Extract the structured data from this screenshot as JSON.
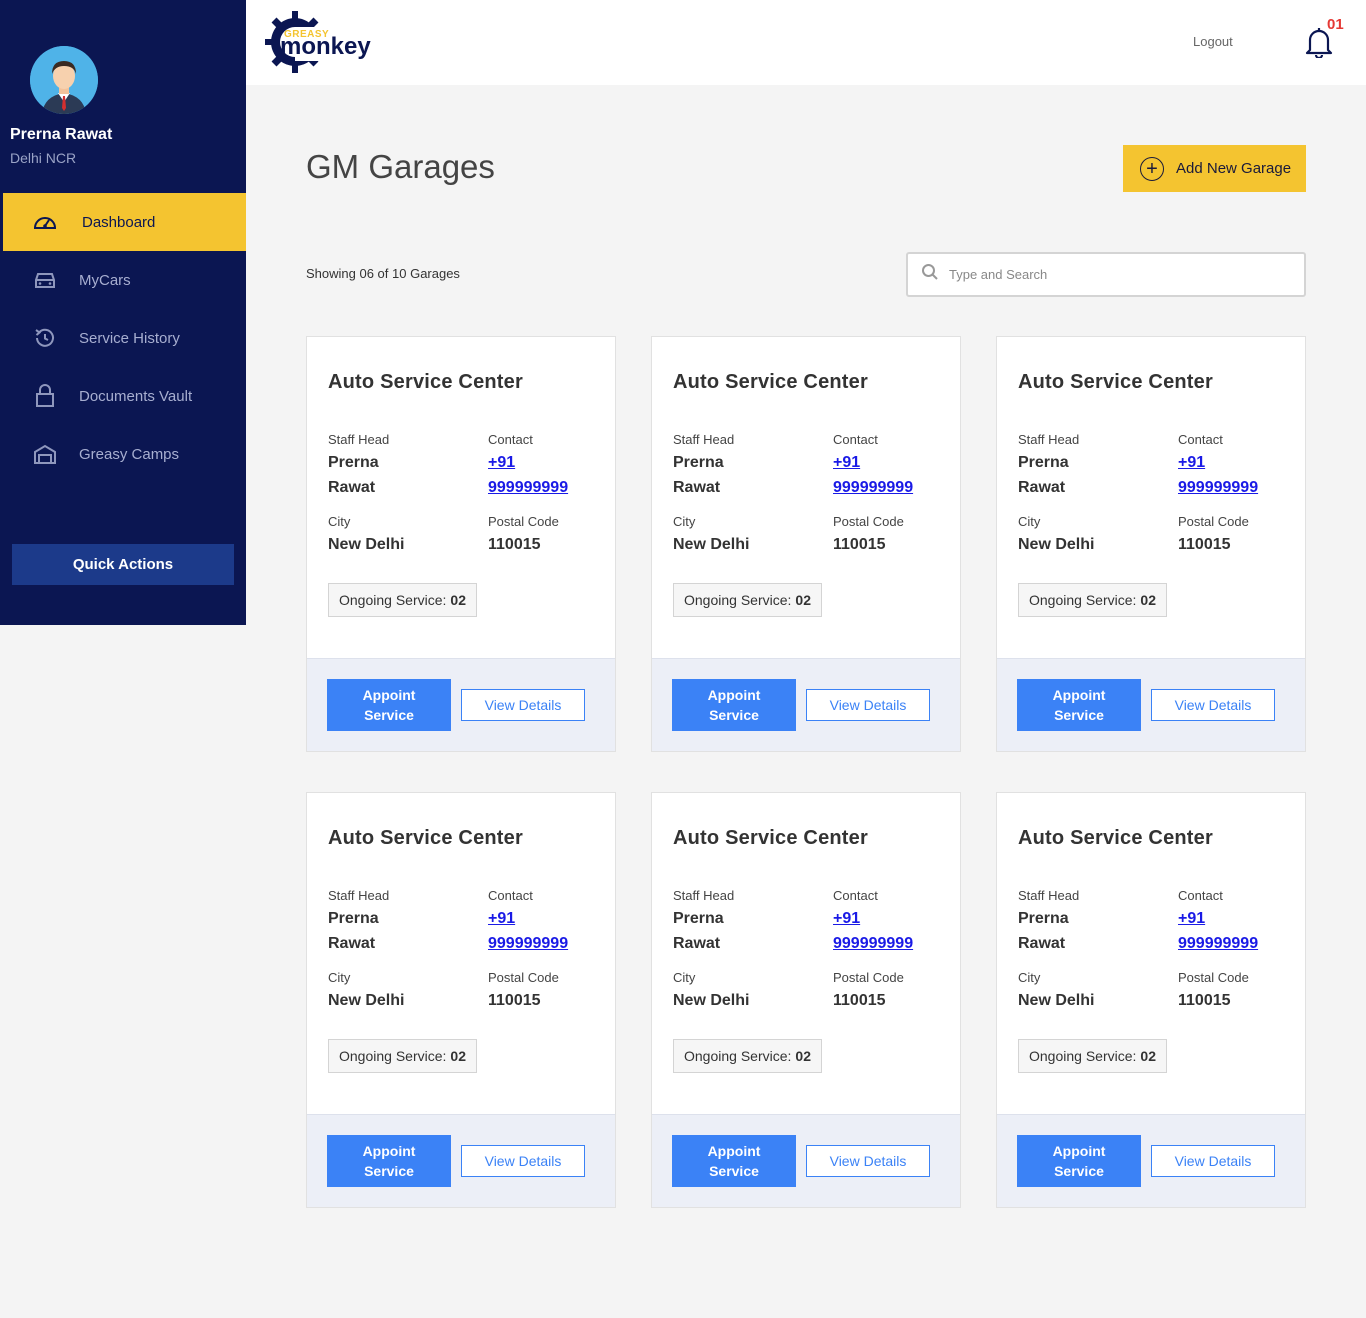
{
  "user": {
    "name": "Prerna Rawat",
    "location": "Delhi NCR"
  },
  "sidebar": {
    "items": [
      {
        "label": "Dashboard",
        "icon": "speedometer-icon",
        "active": true
      },
      {
        "label": "MyCars",
        "icon": "car-icon"
      },
      {
        "label": "Service History",
        "icon": "history-icon"
      },
      {
        "label": "Documents Vault",
        "icon": "lock-icon"
      },
      {
        "label": "Greasy Camps",
        "icon": "garage-icon"
      }
    ],
    "quick_actions": "Quick Actions"
  },
  "header": {
    "logo_top": "GREASY",
    "logo_main": "monkey",
    "logout": "Logout",
    "notification_count": "01"
  },
  "page": {
    "title": "GM Garages",
    "add_button": "Add New Garage",
    "showing": "Showing 06 of 10 Garages",
    "search_placeholder": "Type and Search"
  },
  "card_labels": {
    "staff_head": "Staff Head",
    "contact": "Contact",
    "city": "City",
    "postal_code": "Postal Code",
    "ongoing": "Ongoing Service:",
    "appoint_line1": "Appoint",
    "appoint_line2": "Service",
    "view_details": "View Details"
  },
  "garages": [
    {
      "name": "Auto Service Center",
      "staff_first": "Prerna",
      "staff_last": "Rawat",
      "phone_code": "+91",
      "phone": "999999999",
      "city": "New Delhi",
      "postal": "110015",
      "ongoing": "02"
    },
    {
      "name": "Auto Service Center",
      "staff_first": "Prerna",
      "staff_last": "Rawat",
      "phone_code": "+91",
      "phone": "999999999",
      "city": "New Delhi",
      "postal": "110015",
      "ongoing": "02"
    },
    {
      "name": "Auto Service Center",
      "staff_first": "Prerna",
      "staff_last": "Rawat",
      "phone_code": "+91",
      "phone": "999999999",
      "city": "New Delhi",
      "postal": "110015",
      "ongoing": "02"
    },
    {
      "name": "Auto Service Center",
      "staff_first": "Prerna",
      "staff_last": "Rawat",
      "phone_code": "+91",
      "phone": "999999999",
      "city": "New Delhi",
      "postal": "110015",
      "ongoing": "02"
    },
    {
      "name": "Auto Service Center",
      "staff_first": "Prerna",
      "staff_last": "Rawat",
      "phone_code": "+91",
      "phone": "999999999",
      "city": "New Delhi",
      "postal": "110015",
      "ongoing": "02"
    },
    {
      "name": "Auto Service Center",
      "staff_first": "Prerna",
      "staff_last": "Rawat",
      "phone_code": "+91",
      "phone": "999999999",
      "city": "New Delhi",
      "postal": "110015",
      "ongoing": "02"
    }
  ],
  "colors": {
    "sidebar": "#0b1652",
    "accent": "#f4c430",
    "primary": "#3b82f6",
    "badge": "#e53935"
  }
}
